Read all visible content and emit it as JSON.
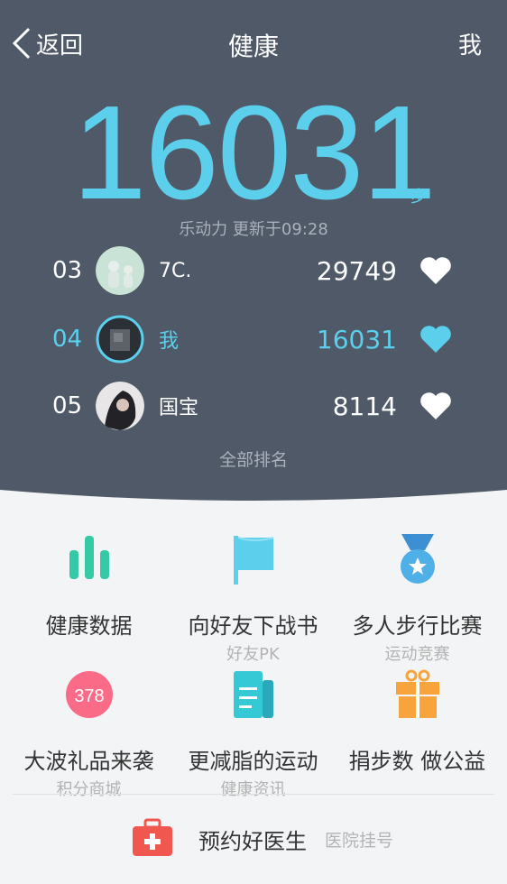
{
  "nav": {
    "back_label": "返回",
    "title": "健康",
    "me_label": "我"
  },
  "summary": {
    "steps": "16031",
    "unit": "步",
    "update_text": "乐动力 更新于09:28"
  },
  "ranking": [
    {
      "rank": "03",
      "name": "7C.",
      "score": "29749",
      "is_me": false
    },
    {
      "rank": "04",
      "name": "我",
      "score": "16031",
      "is_me": true
    },
    {
      "rank": "05",
      "name": "国宝",
      "score": "8114",
      "is_me": false
    }
  ],
  "all_rank_label": "全部排名",
  "features": [
    {
      "label": "健康数据",
      "sub": "",
      "icon": "bar-chart-icon"
    },
    {
      "label": "向好友下战书",
      "sub": "好友PK",
      "icon": "flag-icon"
    },
    {
      "label": "多人步行比赛",
      "sub": "运动竞赛",
      "icon": "medal-icon"
    },
    {
      "label": "大波礼品来袭",
      "sub": "积分商城",
      "icon": "points-badge-icon",
      "badge": "378"
    },
    {
      "label": "更减脂的运动",
      "sub": "健康资讯",
      "icon": "document-icon"
    },
    {
      "label": "捐步数 做公益",
      "sub": "",
      "icon": "gift-icon"
    }
  ],
  "doctor": {
    "label": "预约好医生",
    "sub": "医院挂号",
    "icon": "medical-kit-icon"
  },
  "colors": {
    "header_bg": "#4f5967",
    "accent": "#5ccfed",
    "green": "#35c9a6",
    "pink": "#f96b87",
    "orange": "#f7a43c",
    "red": "#f0584f"
  }
}
